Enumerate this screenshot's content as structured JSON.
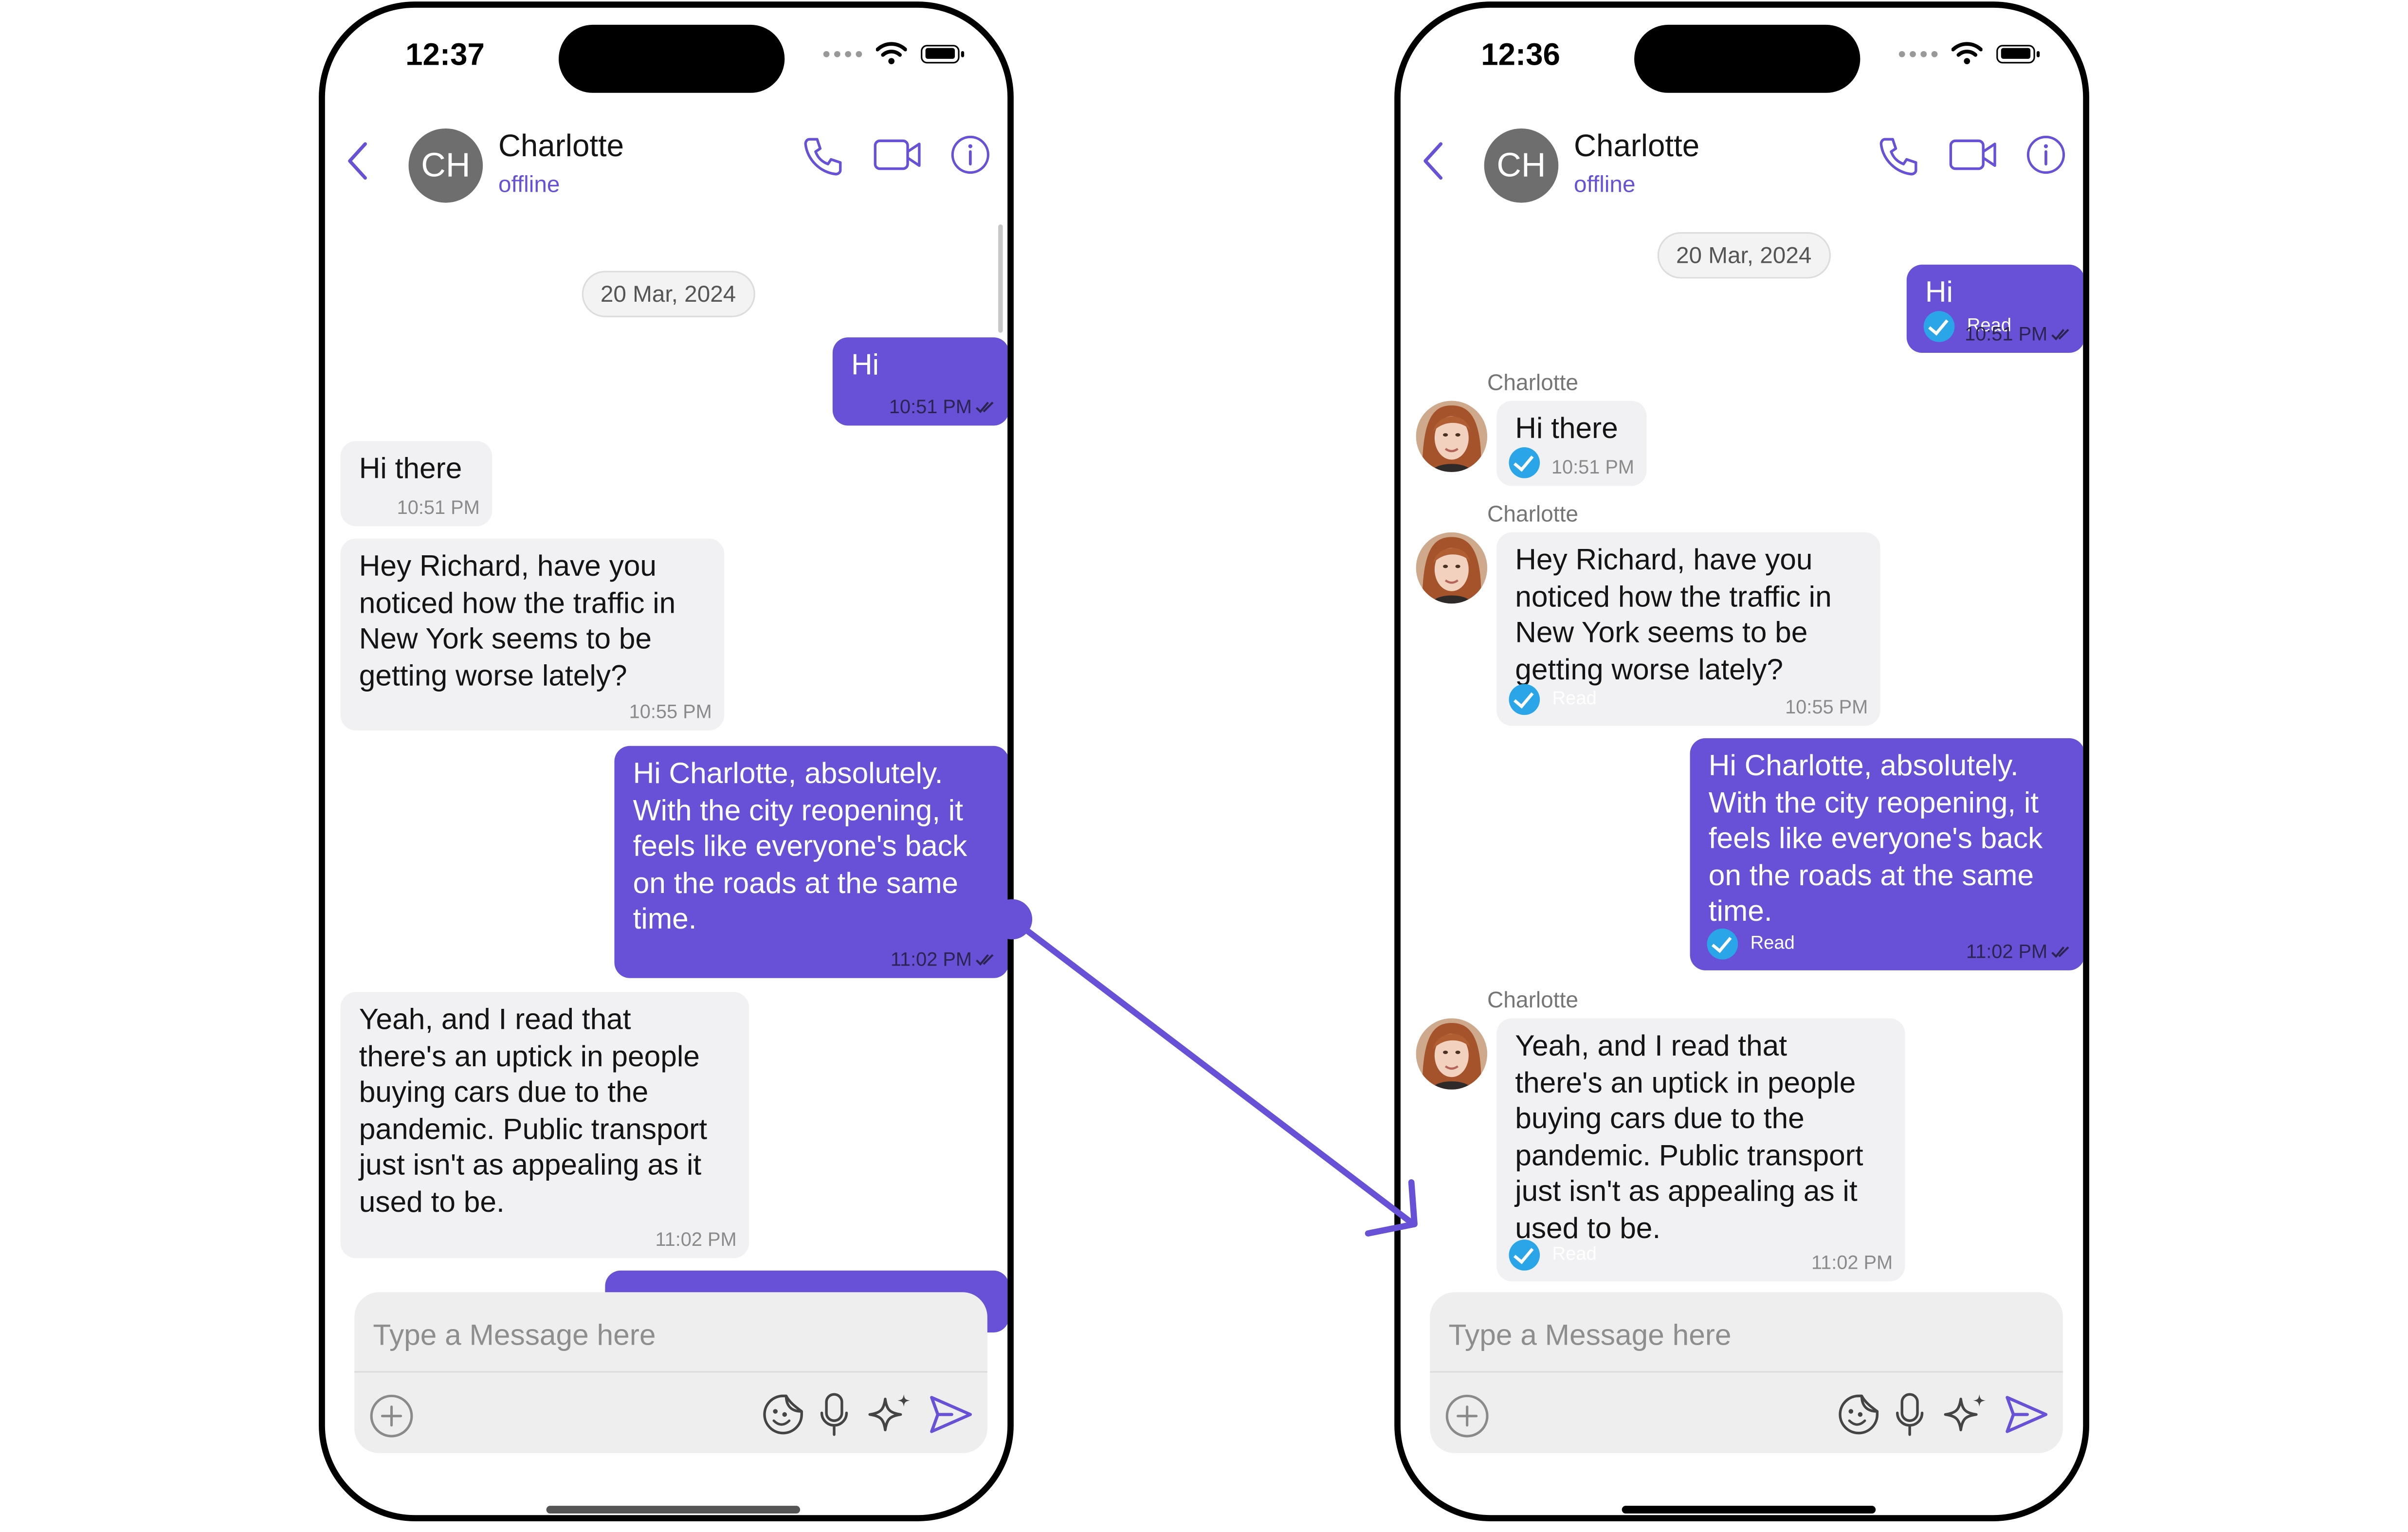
{
  "colors": {
    "accent": "#6851d6",
    "incoming_bubble": "#f1f1f4",
    "read_receipt": "#2aa6e8"
  },
  "left_phone": {
    "status_time": "12:37",
    "header": {
      "avatar_initials": "CH",
      "name": "Charlotte",
      "presence": "offline"
    },
    "date_separator": "20 Mar, 2024",
    "messages": [
      {
        "text": "Hi",
        "time": "10:51 PM"
      },
      {
        "text": "Hi there",
        "time": "10:51 PM"
      },
      {
        "text": "Hey Richard, have you\nnoticed how the traffic in\nNew York seems to be\ngetting worse lately?",
        "time": "10:55 PM"
      },
      {
        "text": "Hi Charlotte, absolutely.\nWith the city reopening, it\nfeels like everyone's back\non the roads at the same\ntime.",
        "time": "11:02 PM"
      },
      {
        "text": "Yeah, and I read that\nthere's an uptick in people\nbuying cars due to the\npandemic. Public transport\njust isn't as appealing as it\nused to be.",
        "time": "11:02 PM"
      }
    ],
    "composer": {
      "placeholder": "Type a Message here"
    }
  },
  "right_phone": {
    "status_time": "12:36",
    "header": {
      "avatar_initials": "CH",
      "name": "Charlotte",
      "presence": "offline"
    },
    "date_separator": "20 Mar, 2024",
    "messages": [
      {
        "text": "Hi",
        "time": "10:51 PM",
        "receipt": "Read"
      },
      {
        "sender": "Charlotte",
        "text": "Hi there",
        "time": "10:51 PM"
      },
      {
        "sender": "Charlotte",
        "text": "Hey Richard, have you\nnoticed how the traffic in\nNew York seems to be\ngetting worse lately?",
        "time": "10:55 PM",
        "receipt": "Read"
      },
      {
        "text": "Hi Charlotte, absolutely.\nWith the city reopening, it\nfeels like everyone's back\non the roads at the same\ntime.",
        "time": "11:02 PM",
        "receipt": "Read"
      },
      {
        "sender": "Charlotte",
        "text": "Yeah, and I read that\nthere's an uptick in people\nbuying cars due to the\npandemic. Public transport\njust isn't as appealing as it\nused to be.",
        "time": "11:02 PM",
        "receipt": "Read"
      }
    ],
    "composer": {
      "placeholder": "Type a Message here"
    }
  }
}
